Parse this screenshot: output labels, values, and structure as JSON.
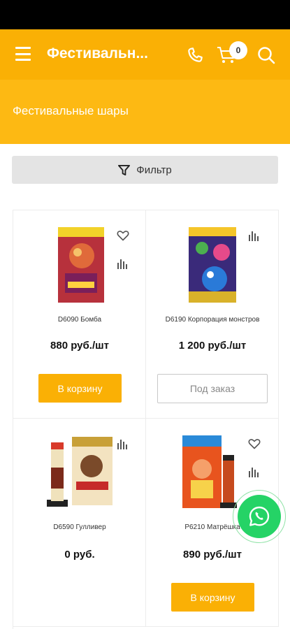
{
  "header": {
    "title": "Фестивальн...",
    "cart_count": "0",
    "icons": [
      "menu-icon",
      "phone-icon",
      "cart-icon",
      "search-icon"
    ],
    "background": "#fab005"
  },
  "category": {
    "title": "Фестивальные шары"
  },
  "filter": {
    "label": "Фильтр",
    "icon": "funnel-icon"
  },
  "products": [
    {
      "name": "D6090 Бомба",
      "price": "880 руб./шт",
      "action": "В корзину",
      "action_type": "cart"
    },
    {
      "name": "D6190 Корпорация монстров",
      "price": "1 200 руб./шт",
      "action": "Под заказ",
      "action_type": "order"
    },
    {
      "name": "D6590 Гулливер",
      "price": "0 руб.",
      "action": "",
      "action_type": "none"
    },
    {
      "name": "P6210 Матрёшка",
      "price": "890 руб./шт",
      "action": "В корзину",
      "action_type": "cart"
    }
  ],
  "colors": {
    "accent": "#fab005",
    "whatsapp": "#25d366"
  }
}
